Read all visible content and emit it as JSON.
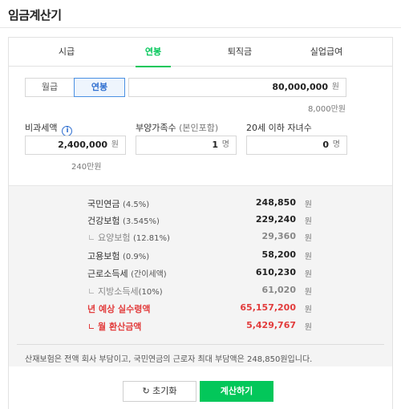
{
  "app": {
    "title": "임금계산기"
  },
  "tabs": [
    {
      "label": "시급"
    },
    {
      "label": "연봉"
    },
    {
      "label": "퇴직금"
    },
    {
      "label": "실업급여"
    }
  ],
  "period_toggle": {
    "monthly": "월급",
    "yearly": "연봉"
  },
  "salary": {
    "value": "80,000,000",
    "unit": "원",
    "hint": "8,000만원"
  },
  "nontax": {
    "label": "비과세액",
    "value": "2,400,000",
    "unit": "원",
    "hint": "240만원"
  },
  "dependents": {
    "label": "부양가족수",
    "label_note": "(본인포함)",
    "value": "1",
    "unit": "명"
  },
  "children": {
    "label": "20세 이하 자녀수",
    "value": "0",
    "unit": "명"
  },
  "results": {
    "pension": {
      "label": "국민연금",
      "pct": "(4.5%)",
      "value": "248,850",
      "unit": "원"
    },
    "health": {
      "label": "건강보험",
      "pct": "(3.545%)",
      "value": "229,240",
      "unit": "원"
    },
    "care": {
      "label": "요양보험",
      "pct": "(12.81%)",
      "value": "29,360",
      "unit": "원"
    },
    "employment": {
      "label": "고용보험",
      "pct": "(0.9%)",
      "value": "58,200",
      "unit": "원"
    },
    "income_tax": {
      "label": "근로소득세",
      "pct": "(간이세액)",
      "value": "610,230",
      "unit": "원"
    },
    "local_tax": {
      "label": "지방소득세",
      "pct": "(10%)",
      "value": "61,020",
      "unit": "원"
    },
    "annual_net": {
      "label": "년 예상 실수령액",
      "value": "65,157,200",
      "unit": "원"
    },
    "monthly_net": {
      "label": "월 환산금액",
      "value": "5,429,767",
      "unit": "원"
    }
  },
  "note": "산재보험은 전액 회사 부담이고, 국민연금의 근로자 최대 부담액은 248,850원입니다.",
  "buttons": {
    "reset": "초기화",
    "calculate": "계산하기"
  },
  "colors": {
    "accent": "#03c75a",
    "highlight": "#e23c3c",
    "toggle": "#2f6fd0"
  }
}
